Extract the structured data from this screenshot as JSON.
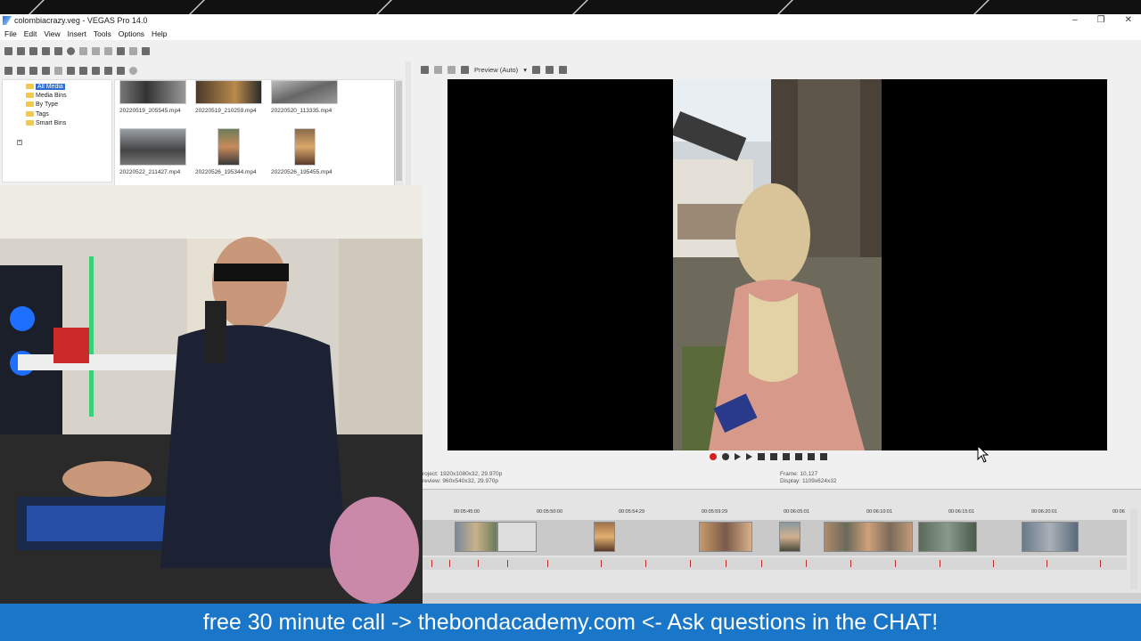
{
  "window": {
    "title": "colombiacrazy.veg - VEGAS Pro 14.0"
  },
  "menu": [
    "File",
    "Edit",
    "View",
    "Insert",
    "Tools",
    "Options",
    "Help"
  ],
  "tree": {
    "items": [
      {
        "label": "All Media",
        "selected": true
      },
      {
        "label": "Media Bins"
      },
      {
        "label": "By Type"
      },
      {
        "label": "Tags"
      },
      {
        "label": "Smart Bins"
      }
    ]
  },
  "media": {
    "files": [
      "20220519_205545.mp4",
      "20220519_210259.mp4",
      "20220520_113335.mp4",
      "20220522_211427.mp4",
      "20220526_195344.mp4",
      "20220526_195455.mp4"
    ]
  },
  "preview": {
    "mode_label": "Preview (Auto)",
    "project_label": "roject:",
    "project_value": "1920x1080x32, 29.970p",
    "preview_label": "review:",
    "preview_value": "960x540x32, 29.970p",
    "frame_label": "Frame:",
    "frame_value": "10,127",
    "display_label": "Display:",
    "display_value": "1109x624x32"
  },
  "timeline": {
    "ruler": [
      "00:05:45:00",
      "00:05:50:00",
      "00:05:54:29",
      "00:05:59:29",
      "00:06:05:01",
      "00:06:10:01",
      "00:06:15:01",
      "00:06:20:01",
      "00:06"
    ]
  },
  "banner": {
    "text": "free 30 minute call -> thebondacademy.com <- Ask questions in the CHAT!"
  },
  "colors": {
    "accent": "#1976c9",
    "selection": "#2f6fd1",
    "record": "#d42020"
  }
}
